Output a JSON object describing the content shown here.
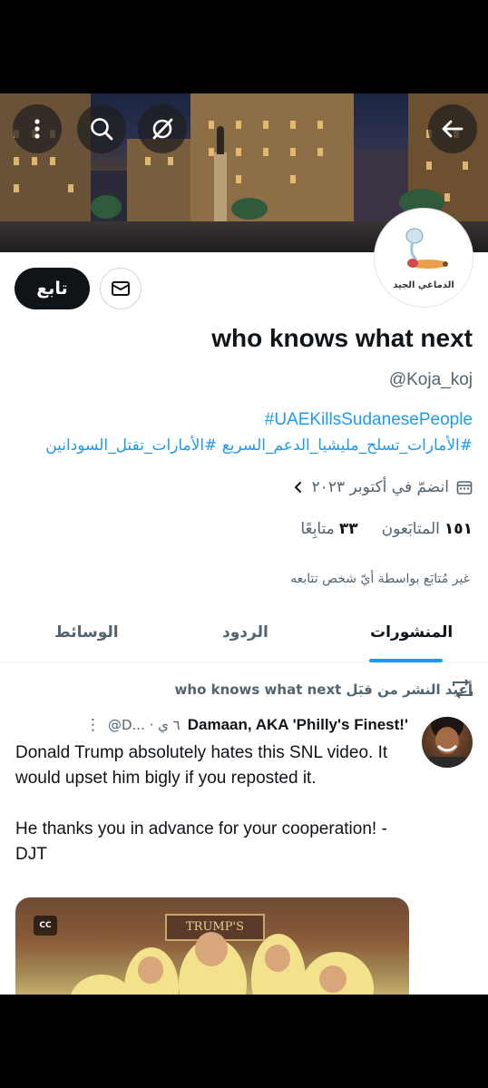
{
  "banner": {
    "back_icon": "arrow-left-icon",
    "grok_icon": "slash-circle-icon",
    "search_icon": "search-icon",
    "more_icon": "more-vertical-icon"
  },
  "profile": {
    "avatar_caption": "الدماغي الجيد",
    "follow_label": "تابع",
    "display_name": "who knows what next",
    "handle": "@Koja_koj",
    "bio_line1": "#UAEKillsSudanesePeople",
    "bio_line2": "#الأمارات_تسلح_مليشيا_الدعم_السريع #الأمارات_تقتل_السودانين",
    "joined": "انضمّ في أكتوبر ٢٠٢٣",
    "followers_count": "١٥١",
    "followers_label": "المتابَعون",
    "following_count": "٣٣",
    "following_label": "متابِعًا",
    "not_followed": "غير مُتابَع بواسطة أيّ شخص تتابعه"
  },
  "tabs": [
    {
      "label": "المنشورات",
      "active": true
    },
    {
      "label": "الردود",
      "active": false
    },
    {
      "label": "الوسائط",
      "active": false
    }
  ],
  "post": {
    "retweet_text": "أعيد النشر من قبَل who knows what next",
    "author": "Damaan, AKA 'Philly's Finest!'",
    "meta": "@D... · ٦ ي",
    "paragraph1": "Donald Trump absolutely hates this SNL video. It would upset him bigly if you reposted it.",
    "paragraph2": "He thanks you in advance for your cooperation! -DJT",
    "media_cc": "CC",
    "media_sign": "TRUMP'S"
  },
  "colors": {
    "accent": "#1d9bf0",
    "text": "#0f1419",
    "muted": "#536471"
  }
}
